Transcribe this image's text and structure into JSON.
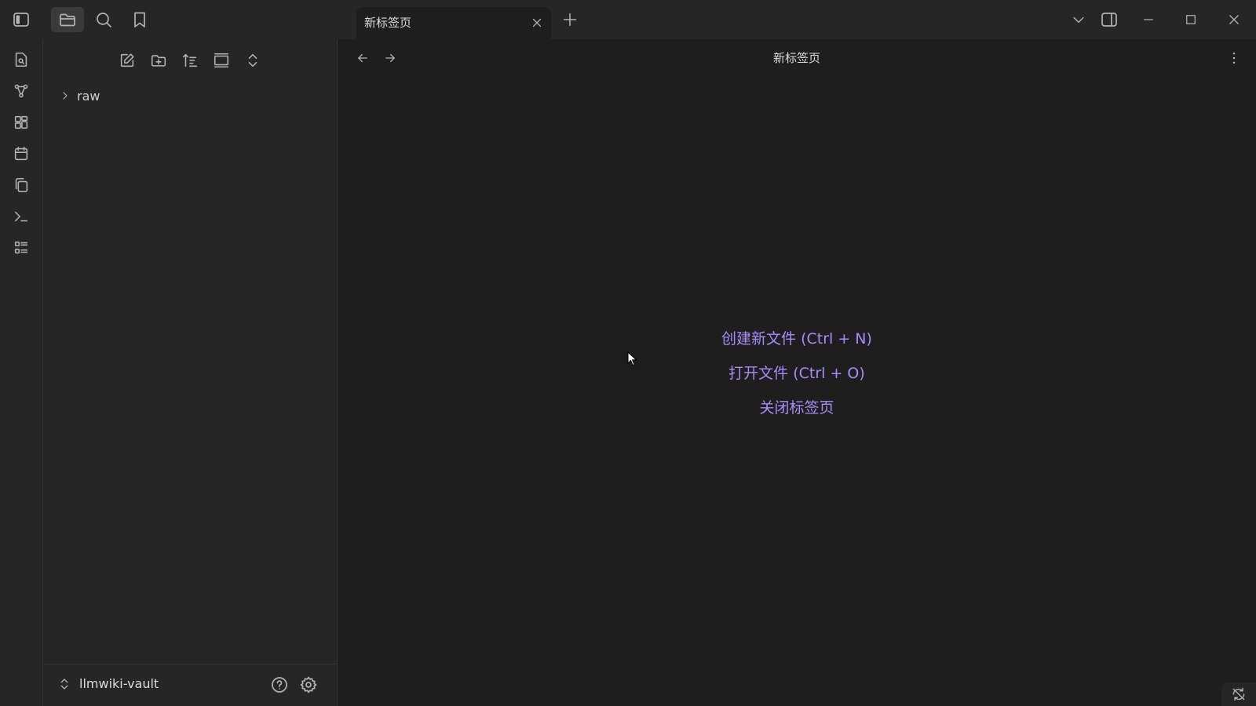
{
  "tab": {
    "title": "新标签页"
  },
  "view": {
    "title": "新标签页"
  },
  "file_tree": {
    "items": [
      {
        "label": "raw",
        "expanded": false
      }
    ]
  },
  "vault": {
    "name": "llmwiki-vault"
  },
  "empty_state": {
    "create_file": "创建新文件 (Ctrl + N)",
    "open_file": "打开文件 (Ctrl + O)",
    "close_tab": "关闭标签页"
  },
  "colors": {
    "accent": "#a88bfa",
    "background": "#1e1e1e",
    "panel": "#262626",
    "sync_error": "#e05555"
  },
  "icons": {
    "topbar": [
      "sidebar-toggle-icon",
      "folder-icon",
      "search-icon",
      "bookmark-icon",
      "plus-icon",
      "chevron-down-icon",
      "right-sidebar-icon",
      "minimize-icon",
      "maximize-icon",
      "close-icon"
    ],
    "ribbon": [
      "file-search-icon",
      "graph-icon",
      "canvas-icon",
      "calendar-icon",
      "copy-icon",
      "terminal-icon",
      "outline-icon"
    ],
    "file_nav": [
      "new-note-icon",
      "new-folder-icon",
      "sort-icon",
      "auto-reveal-icon",
      "collapse-all-icon"
    ]
  }
}
